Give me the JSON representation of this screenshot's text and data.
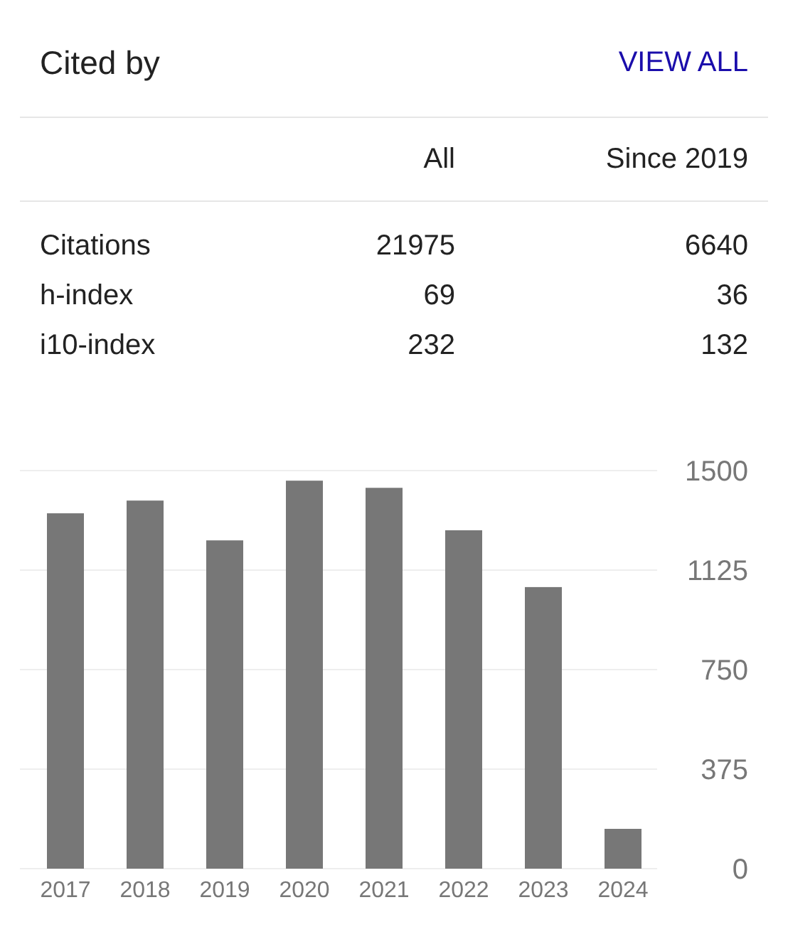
{
  "header": {
    "title": "Cited by",
    "link": "VIEW ALL"
  },
  "table": {
    "columns": [
      "All",
      "Since 2019"
    ],
    "rows": [
      {
        "metric": "Citations",
        "all": "21975",
        "since_2019": "6640"
      },
      {
        "metric": "h-index",
        "all": "69",
        "since_2019": "36"
      },
      {
        "metric": "i10-index",
        "all": "232",
        "since_2019": "132"
      }
    ]
  },
  "chart": {
    "chart_data": {
      "type": "bar",
      "categories": [
        "2017",
        "2018",
        "2019",
        "2020",
        "2021",
        "2022",
        "2023",
        "2024"
      ],
      "values": [
        1339,
        1387,
        1237,
        1462,
        1435,
        1275,
        1061,
        150
      ],
      "ylim": [
        0,
        1500
      ],
      "grid": true,
      "yticks": [
        0,
        375,
        750,
        1125,
        1500
      ]
    }
  }
}
